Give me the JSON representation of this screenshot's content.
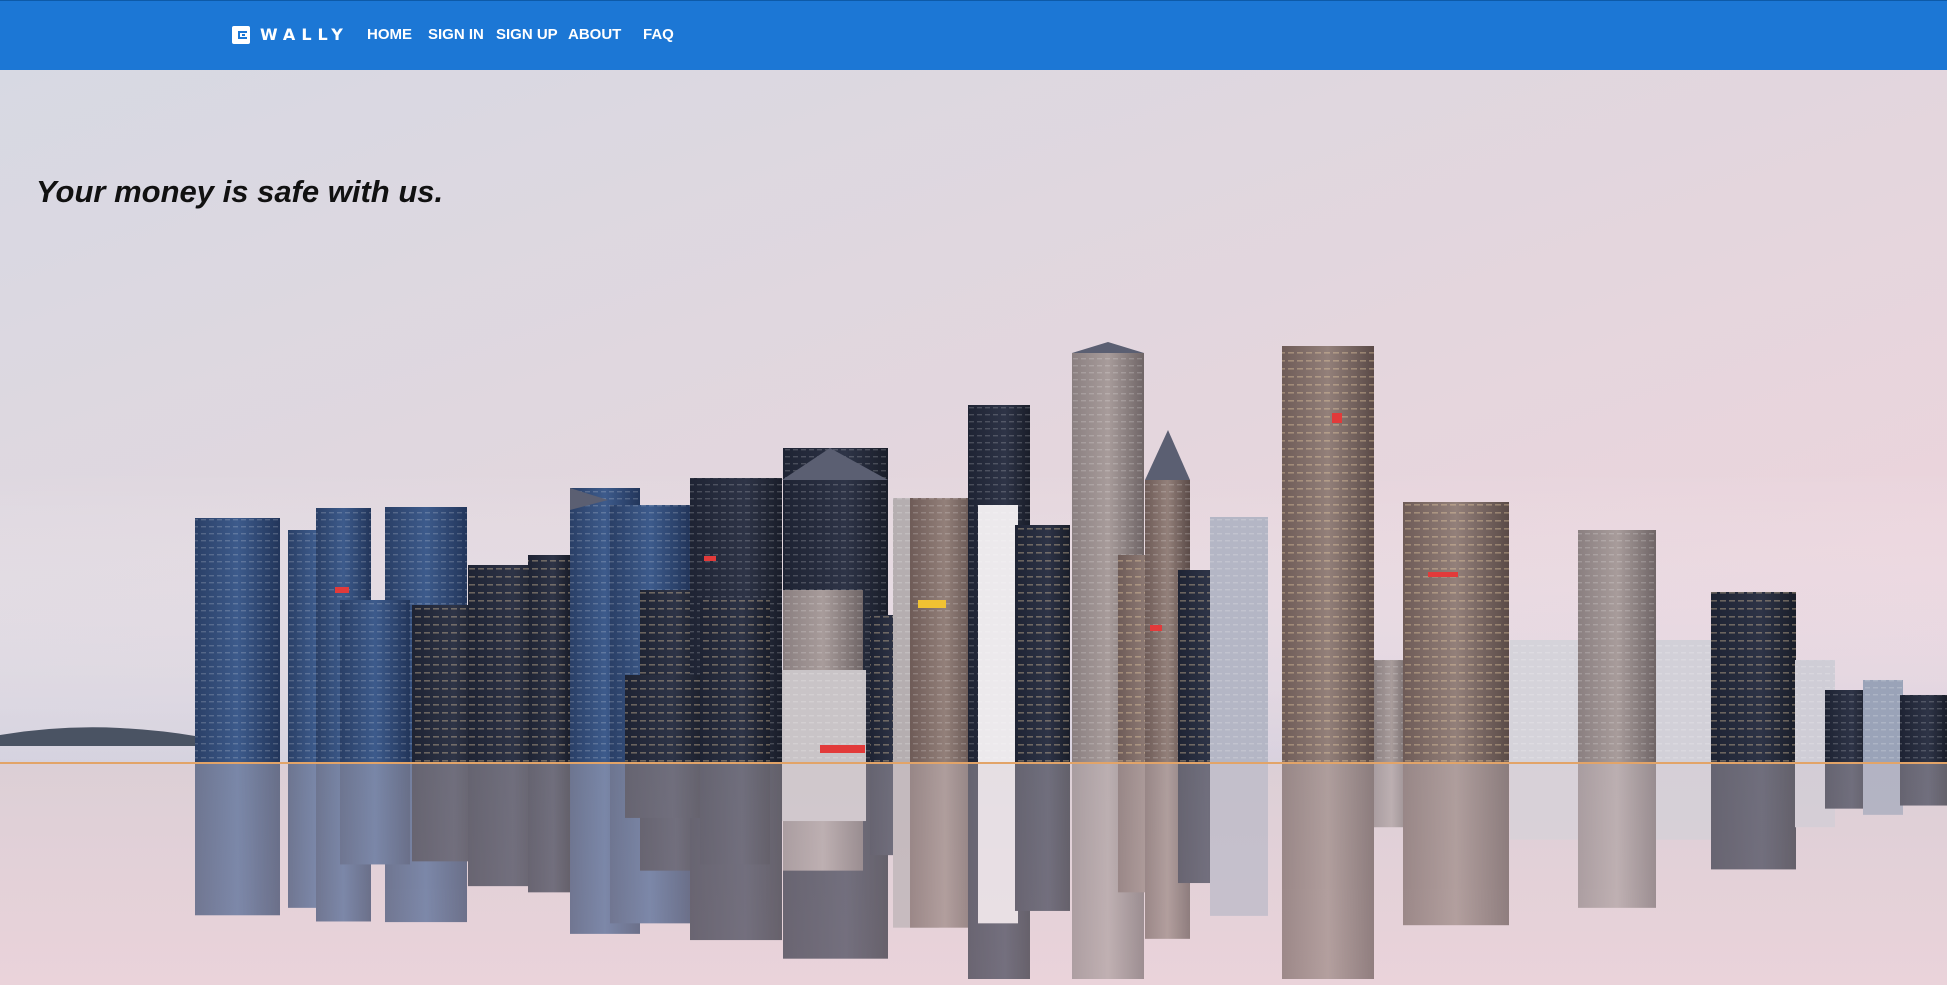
{
  "brand": {
    "name": "WALLY",
    "icon": "wallet-icon"
  },
  "nav": {
    "items": [
      {
        "label": "HOME"
      },
      {
        "label": "SIGN IN"
      },
      {
        "label": "SIGN UP"
      },
      {
        "label": "ABOUT"
      },
      {
        "label": "FAQ"
      }
    ]
  },
  "hero": {
    "tagline": "Your money is safe with us.",
    "image": "city-skyline-reflection",
    "sky_colors": [
      "#d9dbe4",
      "#e8d8dc",
      "#f0d4dc"
    ],
    "water_color": "#e3d2d8",
    "horizon_line_color": "#e0a060",
    "nav_color": "#1c77d5"
  }
}
